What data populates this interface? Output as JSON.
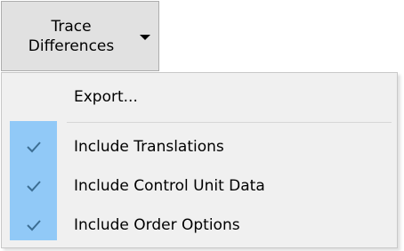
{
  "toolbar": {
    "trace_button_label": "Trace\nDifferences"
  },
  "menu": {
    "export_label": "Export...",
    "options": [
      {
        "label": "Include Translations",
        "checked": true,
        "icon": "check-icon"
      },
      {
        "label": "Include Control Unit Data",
        "checked": true,
        "icon": "check-icon"
      },
      {
        "label": "Include Order Options",
        "checked": true,
        "icon": "check-icon"
      }
    ]
  },
  "colors": {
    "button_bg": "#e1e1e1",
    "menu_bg": "#f0f0f0",
    "check_strip": "#91c9f7",
    "check_mark": "#3c6e94"
  }
}
